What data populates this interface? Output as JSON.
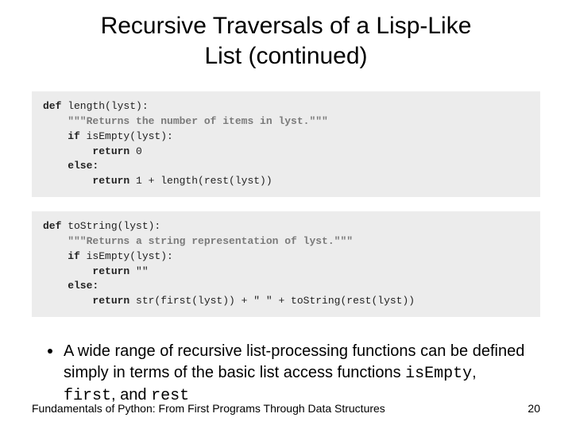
{
  "title_line1": "Recursive Traversals of a Lisp-Like",
  "title_line2": "List (continued)",
  "code1": {
    "l1a": "def",
    "l1b": " length(lyst):",
    "l2": "    \"\"\"Returns the number of items in lyst.\"\"\"",
    "l3a": "    if",
    "l3b": " isEmpty(lyst):",
    "l4a": "        return",
    "l4b": " 0",
    "l5": "    else:",
    "l6a": "        return",
    "l6b": " 1 + length(rest(lyst))"
  },
  "code2": {
    "l1a": "def",
    "l1b": " toString(lyst):",
    "l2": "    \"\"\"Returns a string representation of lyst.\"\"\"",
    "l3a": "    if",
    "l3b": " isEmpty(lyst):",
    "l4a": "        return",
    "l4b": " \"\"",
    "l5": "    else:",
    "l6a": "        return",
    "l6b": " str(first(lyst)) + \" \" + toString(rest(lyst))"
  },
  "bullet": {
    "pre": "A wide range of recursive list-processing functions can be defined simply in terms of the basic list access functions ",
    "fn1": "isEmpty",
    "sep1": ", ",
    "fn2": "first",
    "sep2": ", and ",
    "fn3": "rest"
  },
  "footer_left": "Fundamentals of Python: From First Programs Through Data Structures",
  "footer_right": "20"
}
